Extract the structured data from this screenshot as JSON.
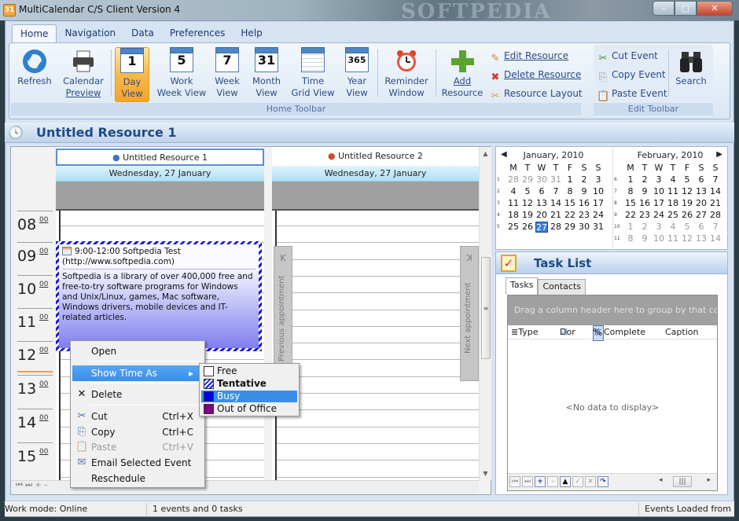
{
  "window": {
    "title": "MultiCalendar C/S Client Version 4",
    "watermark": "SOFTPEDIA",
    "controls": {
      "minimize": "–",
      "maximize": "□",
      "close": "✕"
    }
  },
  "menu_tabs": [
    "Home",
    "Navigation",
    "Data",
    "Preferences",
    "Help"
  ],
  "ribbon": {
    "home_toolbar": {
      "label": "Home Toolbar",
      "buttons": [
        {
          "line1": "Refresh",
          "line2": "",
          "icon": "refresh-icon"
        },
        {
          "line1": "Calendar",
          "line2": "Preview",
          "icon": "printer-icon"
        },
        {
          "line1": "Day",
          "line2": "View",
          "icon": "calendar-day-icon",
          "glyph": "1",
          "active": true
        },
        {
          "line1": "Work",
          "line2": "Week View",
          "icon": "calendar-workweek-icon",
          "glyph": "5"
        },
        {
          "line1": "Week",
          "line2": "View",
          "icon": "calendar-week-icon",
          "glyph": "7"
        },
        {
          "line1": "Month",
          "line2": "View",
          "icon": "calendar-month-icon",
          "glyph": "31"
        },
        {
          "line1": "Time",
          "line2": "Grid View",
          "icon": "time-grid-icon",
          "glyph": ""
        },
        {
          "line1": "Year",
          "line2": "View",
          "icon": "calendar-year-icon",
          "glyph": "365"
        },
        {
          "line1": "Reminder",
          "line2": "Window",
          "icon": "alarm-clock-icon"
        },
        {
          "line1": "Add",
          "line2": "Resource",
          "icon": "add-icon"
        }
      ],
      "resource_actions": [
        "Edit Resource",
        "Delete Resource",
        "Resource Layout"
      ]
    },
    "edit_toolbar": {
      "label": "Edit Toolbar",
      "actions": [
        "Cut Event",
        "Copy Event",
        "Paste Event"
      ],
      "search": "Search"
    }
  },
  "resource_header": {
    "title": "Untitled Resource 1"
  },
  "scheduler": {
    "resources": [
      {
        "name": "Untitled Resource 1",
        "date": "Wednesday, 27 January",
        "selected": true
      },
      {
        "name": "Untitled Resource 2",
        "date": "Wednesday, 27 January",
        "selected": false
      }
    ],
    "hours": [
      "08",
      "09",
      "10",
      "11",
      "12",
      "13",
      "14",
      "15"
    ],
    "minutes": "00",
    "appointment": {
      "subject": "9:00-12:00 Softpedia Test",
      "subject2": "(http://www.softpedia.com)",
      "body": "Softpedia is a library of over 400,000 free and free-to-try software programs for Windows and Unix/Linux, games, Mac software, Windows drivers, mobile devices and IT-related articles.",
      "show_time_as": "Tentative",
      "color": "#1a1ad8"
    },
    "prev_appointment": "Previous appointment",
    "next_appointment": "Next appointment",
    "nav_arrows": {
      "prev": "K",
      "next": "K"
    },
    "bottom_nav": "⏮ ⏭ + –"
  },
  "context_menu": {
    "items": [
      {
        "label": "Open",
        "shortcut": "",
        "icon": ""
      },
      {
        "label": "Show Time As",
        "shortcut": "▸",
        "icon": "",
        "highlighted": true
      },
      {
        "label": "Delete",
        "shortcut": "",
        "icon": "✕"
      },
      {
        "label": "Cut",
        "shortcut": "Ctrl+X",
        "icon": "✂"
      },
      {
        "label": "Copy",
        "shortcut": "Ctrl+C",
        "icon": "⎘"
      },
      {
        "label": "Paste",
        "shortcut": "Ctrl+V",
        "icon": "📋",
        "disabled": true
      },
      {
        "label": "Email Selected Event",
        "shortcut": "",
        "icon": "✉"
      },
      {
        "label": "Reschedule",
        "shortcut": "",
        "icon": ""
      }
    ],
    "submenu": [
      {
        "label": "Free",
        "swatch": "#ffffff"
      },
      {
        "label": "Tentative",
        "swatch": "hatched",
        "bold": true
      },
      {
        "label": "Busy",
        "swatch": "#0000e0",
        "highlighted": true
      },
      {
        "label": "Out of Office",
        "swatch": "#800080"
      }
    ]
  },
  "mini_calendar": {
    "months": [
      {
        "title": "January, 2010",
        "weekdays": [
          "M",
          "T",
          "W",
          "T",
          "F",
          "S",
          "S"
        ],
        "weeks": [
          1,
          2,
          3,
          4,
          5
        ],
        "days": [
          [
            28,
            29,
            30,
            31,
            1,
            2,
            3
          ],
          [
            4,
            5,
            6,
            7,
            8,
            9,
            10
          ],
          [
            11,
            12,
            13,
            14,
            15,
            16,
            17
          ],
          [
            18,
            19,
            20,
            21,
            22,
            23,
            24
          ],
          [
            25,
            26,
            27,
            28,
            29,
            30,
            31
          ]
        ],
        "other_month_first_row": 4,
        "today": 27
      },
      {
        "title": "February, 2010",
        "weekdays": [
          "M",
          "T",
          "W",
          "T",
          "F",
          "S",
          "S"
        ],
        "weeks": [
          6,
          7,
          8,
          9,
          10,
          11
        ],
        "days": [
          [
            1,
            2,
            3,
            4,
            5,
            6,
            7
          ],
          [
            8,
            9,
            10,
            11,
            12,
            13,
            14
          ],
          [
            15,
            16,
            17,
            18,
            19,
            20,
            21
          ],
          [
            22,
            23,
            24,
            25,
            26,
            27,
            28
          ],
          [
            1,
            2,
            3,
            4,
            5,
            6,
            7
          ],
          [
            8,
            9,
            10,
            11,
            12,
            13,
            14
          ]
        ],
        "other_month_rows_from": 4
      }
    ],
    "prev_arrow": "◀",
    "next_arrow": "▶"
  },
  "task_list": {
    "title": "Task List",
    "tabs": [
      "Tasks",
      "Contacts"
    ],
    "group_hint": "Drag a column header here to group by that column",
    "columns": [
      "Type",
      "Dor",
      "% Complete",
      "Caption"
    ],
    "empty": "<No data to display>",
    "nav_buttons": [
      "⏮",
      "⏭",
      "+",
      "–",
      "▲",
      "✓",
      "✕",
      "↷"
    ]
  },
  "status_bar": {
    "work_mode": "Work mode: Online",
    "counts": "1 events and 0 tasks",
    "loaded": "Events Loaded from"
  }
}
